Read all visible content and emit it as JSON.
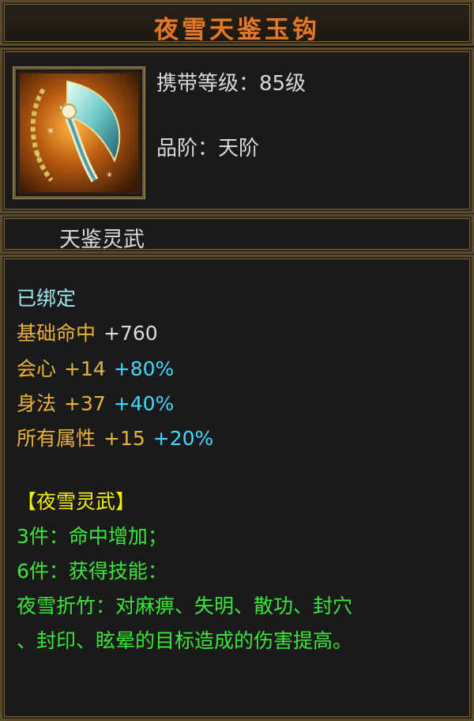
{
  "item": {
    "name": "夜雪天鉴玉钩",
    "level_label": "携带等级：85级",
    "grade_label": "品阶：天阶",
    "category": "天鉴灵武",
    "icon": "jade-hook-weapon-icon"
  },
  "stats": {
    "bound": "已绑定",
    "base_label": "基础命中",
    "base_value": "+760",
    "rows": [
      {
        "label": "会心",
        "value": "+14",
        "bonus": "+80%"
      },
      {
        "label": "身法",
        "value": "+37",
        "bonus": "+40%"
      },
      {
        "label": "所有属性",
        "value": "+15",
        "bonus": "+20%"
      }
    ]
  },
  "set_bonus": {
    "name": "【夜雪灵武】",
    "tier3": "3件：命中增加；",
    "tier6": "6件：获得技能：",
    "skill_line1": "夜雪折竹：对麻痹、失明、散功、封穴",
    "skill_line2": "、封印、眩晕的目标造成的伤害提高。"
  },
  "colors": {
    "title": "#e07a2a",
    "stat_label": "#e8b23a",
    "bonus": "#3fd8ff",
    "set_name": "#f2f000",
    "set_text": "#38e838",
    "bound": "#9ee6f0"
  }
}
